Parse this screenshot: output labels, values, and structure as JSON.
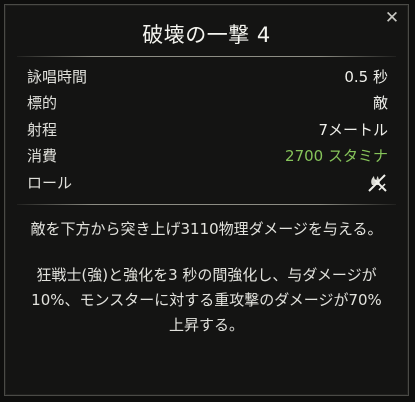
{
  "tooltip": {
    "close_glyph": "✕",
    "title": "破壊の一撃 4",
    "stats": [
      {
        "label": "詠唱時間",
        "value": "0.5 秒"
      },
      {
        "label": "標的",
        "value": "敵"
      },
      {
        "label": "射程",
        "value": "7メートル"
      },
      {
        "label": "消費",
        "value": "2700 スタミナ",
        "color": "#86c45a"
      },
      {
        "label": "ロール",
        "icon": "damage-dealer-role-icon"
      }
    ],
    "description": [
      "敵を下方から突き上げ3110物理ダメージを与える。",
      "狂戦士(強)と強化を3 秒の間強化し、与ダメージが10%、モンスターに対する重攻撃のダメージが70%上昇する。"
    ]
  }
}
